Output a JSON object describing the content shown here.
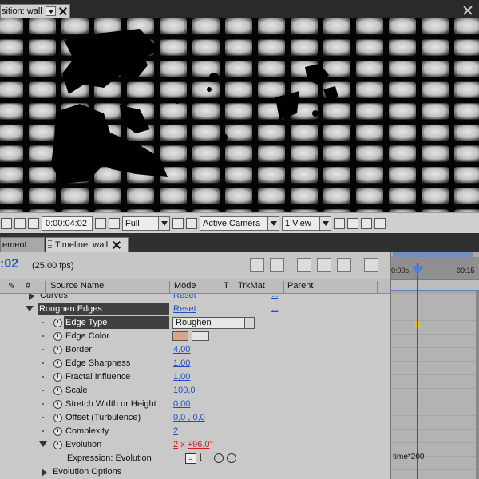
{
  "comp_viewer": {
    "tab_label": "sition: wall",
    "time_display": "0:00:04:02",
    "resolution": "Full",
    "camera": "Active Camera",
    "views": "1 View"
  },
  "timeline": {
    "tabs": [
      {
        "label": "ement"
      },
      {
        "label": "Timeline: wall"
      }
    ],
    "current_time": ":02",
    "fps": "(25,00 fps)",
    "columns": {
      "number": "#",
      "source_name": "Source Name",
      "mode": "Mode",
      "t": "T",
      "trkmat": "TrkMat",
      "parent": "Parent"
    },
    "rows": [
      {
        "label": "Curves",
        "value": "Reset",
        "link": "..."
      },
      {
        "label": "Roughen Edges",
        "value": "Reset",
        "link": "..."
      },
      {
        "label": "Edge Type",
        "value": "Roughen"
      },
      {
        "label": "Edge Color",
        "value": ""
      },
      {
        "label": "Border",
        "value": "4,00"
      },
      {
        "label": "Edge Sharpness",
        "value": "1,00"
      },
      {
        "label": "Fractal Influence",
        "value": "1,00"
      },
      {
        "label": "Scale",
        "value": "100,0"
      },
      {
        "label": "Stretch Width or Height",
        "value": "0,00"
      },
      {
        "label": "Offset (Turbulence)",
        "value": "0,0 , 0,0"
      },
      {
        "label": "Complexity",
        "value": "2"
      },
      {
        "label": "Evolution",
        "value_revolutions": "2",
        "value_x": "x",
        "value_degrees": "+96,0",
        "value_deg_symbol": "°"
      },
      {
        "label": "Expression: Evolution",
        "value": ""
      },
      {
        "label": "Evolution Options",
        "value": ""
      }
    ],
    "ruler": {
      "start": "0:00s",
      "end": "00:15"
    },
    "expression_text": "time*200",
    "edge_color_hex": "#d9a48c",
    "playhead_color": "#d21d1d"
  }
}
